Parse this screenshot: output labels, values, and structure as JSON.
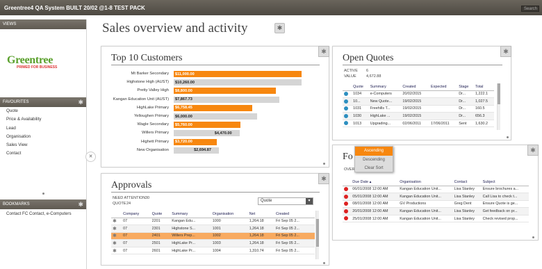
{
  "app": {
    "title": "Greentree4 QA System BUILT 20/02 @1-8 TEST PACK",
    "search_label": "Search"
  },
  "sidebar": {
    "views_label": "VIEWS",
    "logo_word": "Greentree",
    "logo_tag": "PRIMED FOR BUSINESS",
    "favourites_label": "FAVOURITES",
    "favourites": [
      "Quote",
      "Price & Availability",
      "Lead",
      "Organisation",
      "Sales View",
      "Contact"
    ],
    "bookmarks_label": "BOOKMARKS",
    "bookmarks": [
      "Contact FC Contact, e-Computers"
    ]
  },
  "page": {
    "title": "Sales overview and activity"
  },
  "top_customers": {
    "title": "Top 10 Customers",
    "chart_data": {
      "type": "bar",
      "categories": [
        "Mt Barker Secondary",
        "Highstone High (AUST)",
        "Pretty Valley High",
        "Kangan Education Unit (AUST)",
        "HighLake Primary",
        "Yelloughen Primary",
        "Wagle Secondary",
        "Willers Primary",
        "Highett Primary",
        "New Organisation"
      ],
      "values": [
        11000,
        10260,
        8800,
        7867.73,
        6758.45,
        6000,
        5760,
        4470,
        3720,
        2694.87
      ],
      "labels": [
        "$11,000.00",
        "$10,260.00",
        "$8,800.00",
        "$7,867.73",
        "$6,758.45",
        "$6,000.00",
        "$5,760.00",
        "$4,470.00",
        "$3,720.00",
        "$2,694.87"
      ],
      "highlight": [
        true,
        false,
        true,
        false,
        true,
        false,
        true,
        false,
        true,
        false
      ],
      "max": 11000
    }
  },
  "open_quotes": {
    "title": "Open Quotes",
    "active_label": "ACTIVE",
    "active_value": "6",
    "value_label": "VALUE",
    "value_value": "4,672.88",
    "columns": [
      "Quote",
      "Summary",
      "Created",
      "Expected",
      "Stage",
      "Total"
    ],
    "rows": [
      [
        "1034",
        "e-Computers",
        "20/02/2015",
        "",
        "Dr...",
        "1,222.1"
      ],
      [
        "10...",
        "New Quote...",
        "19/02/2015",
        "",
        "Dr...",
        "1,027.5"
      ],
      [
        "1031",
        "Freehills T...",
        "19/02/2015",
        "",
        "Dr...",
        "160.5"
      ],
      [
        "1030",
        "HighLake ...",
        "19/02/2015",
        "",
        "Dr...",
        "656.3"
      ],
      [
        "1013",
        "Upgrading...",
        "02/06/2011",
        "17/06/2011",
        "Sent",
        "1,630.2"
      ]
    ]
  },
  "approvals": {
    "title": "Approvals",
    "need_label": "NEED ATTENTION",
    "need_value": "30",
    "quote_label": "QUOTE",
    "quote_value": "24",
    "filter_value": "Quote",
    "columns": [
      "Company",
      "Quote",
      "Summary",
      "Organisation",
      "Net",
      "Created"
    ],
    "rows": [
      [
        "07",
        "2201",
        "Kangan Edu...",
        "1000",
        "1,264.18",
        "Fri Sep 05 2..."
      ],
      [
        "07",
        "2301",
        "Highstone S...",
        "1001",
        "1,264.18",
        "Fri Sep 05 2..."
      ],
      [
        "07",
        "2401",
        "Willers Prep...",
        "1002",
        "1,264.18",
        "Fri Sep 05 2..."
      ],
      [
        "07",
        "2501",
        "HighLake Pr...",
        "1003",
        "1,264.18",
        "Fri Sep 05 2..."
      ],
      [
        "07",
        "2601",
        "HighLake Pr...",
        "1004",
        "1,310.74",
        "Fri Sep 05 2..."
      ]
    ]
  },
  "followups": {
    "title_visible": "Fo",
    "overdue_label": "OVERD",
    "columns": [
      "Due Date",
      "Organisation",
      "Contact",
      "Subject"
    ],
    "rows": [
      [
        "06/01/2008 12:00 AM",
        "Kangan Education Unit...",
        "Lisa Stanley",
        "Ensure brochures a..."
      ],
      [
        "05/01/2008 12:00 AM",
        "Kangan Education Unit...",
        "Lisa Stanley",
        "Call Lisa to check t..."
      ],
      [
        "08/01/2008 12:00 AM",
        "GV Productions",
        "Greg Dent",
        "Ensure Quote is ge..."
      ],
      [
        "20/01/2008 12:00 AM",
        "Kangan Education Unit...",
        "Lisa Stanley",
        "Get feedback on pr..."
      ],
      [
        "25/01/2008 12:00 AM",
        "Kangan Education Unit...",
        "Lisa Stanley",
        "Check revised prop..."
      ]
    ],
    "sort_menu": [
      "Ascending",
      "Descending",
      "Clear Sort"
    ]
  }
}
